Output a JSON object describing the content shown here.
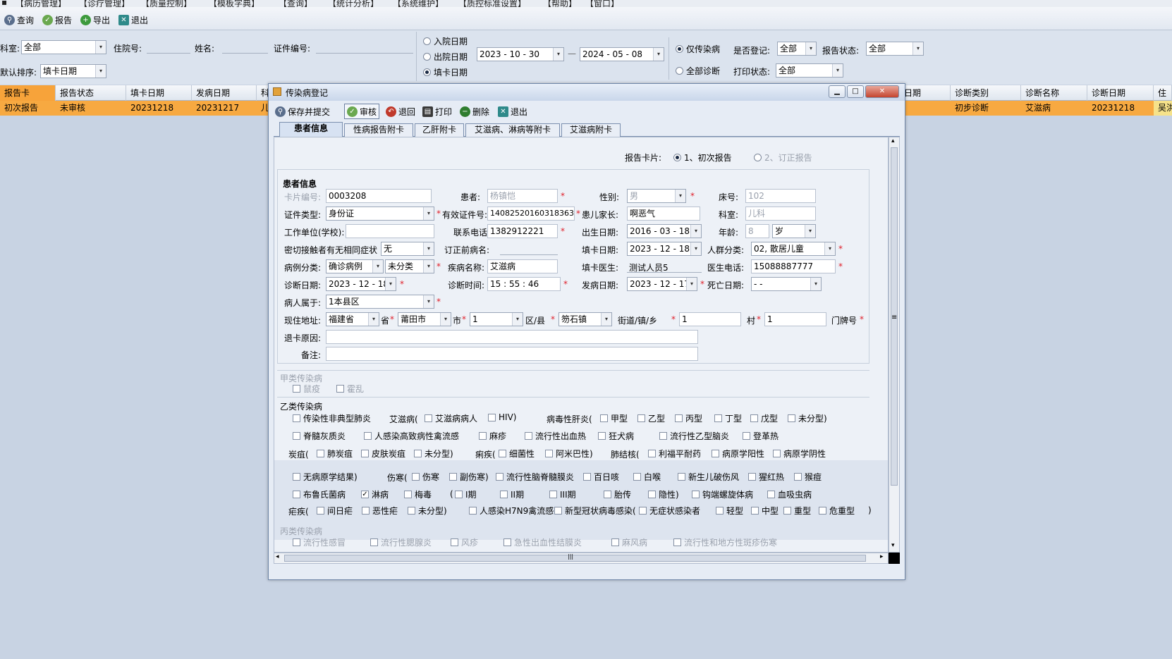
{
  "menubar": [
    "【病历管理】",
    "【诊疗管理】",
    "【质量控制】",
    "【模板字典】",
    "【查询】",
    "【统计分析】",
    "【系统维护】",
    "【质控标准设置】",
    "【帮助】",
    "【窗口】"
  ],
  "toolbar": {
    "query": "查询",
    "report": "报告",
    "export": "导出",
    "exit": "退出"
  },
  "filters": {
    "dept_label": "科室:",
    "dept_value": "全部",
    "inpatient_label": "住院号:",
    "name_label": "姓名:",
    "cert_label": "证件编号:",
    "sort_label": "默认排序:",
    "sort_value": "填卡日期",
    "date_admit": "入院日期",
    "date_discharge": "出院日期",
    "date_card": "填卡日期",
    "date_from": "2023 - 10 - 30",
    "date_to": "2024 - 05 - 08",
    "dash": "—",
    "only_infect": "仅传染病",
    "all_diag": "全部诊断",
    "registered_label": "是否登记:",
    "registered_value": "全部",
    "report_status_label": "报告状态:",
    "report_status_value": "全部",
    "print_status_label": "打印状态:",
    "print_status_value": "全部"
  },
  "grid": {
    "headers_left": [
      "报告卡",
      "报告状态",
      "填卡日期",
      "发病日期",
      "科"
    ],
    "headers_right": [
      "日期",
      "诊断类别",
      "诊断名称",
      "诊断日期",
      "住"
    ],
    "row_left": [
      "初次报告",
      "未审核",
      "20231218",
      "20231217",
      "儿"
    ],
    "row_right": [
      "初步诊断",
      "艾滋病",
      "20231218",
      "吴洪"
    ]
  },
  "dialog": {
    "title": "传染病登记",
    "toolbar": {
      "save": "保存并提交",
      "audit": "审核",
      "back": "退回",
      "print": "打印",
      "delete": "删除",
      "exit": "退出"
    },
    "tabs": [
      "患者信息",
      "性病报告附卡",
      "乙肝附卡",
      "艾滋病、淋病等附卡",
      "艾滋病附卡"
    ],
    "report_card_label": "报告卡片:",
    "report_first": "1、初次报告",
    "report_correct": "2、订正报告",
    "section_patient": "患者信息",
    "f": {
      "card_no_l": "卡片编号:",
      "card_no": "0003208",
      "patient_l": "患者:",
      "patient": "杨镇恺",
      "sex_l": "性别:",
      "sex": "男",
      "bed_l": "床号:",
      "bed": "102",
      "idtype_l": "证件类型:",
      "idtype": "身份证",
      "idno_l": "有效证件号:",
      "idno": "140825201603183630",
      "parent_l": "患儿家长:",
      "parent": "啊恶气",
      "dept_l": "科室:",
      "dept": "儿科",
      "work_l": "工作单位(学校):",
      "work": "",
      "phone_l": "联系电话:",
      "phone": "1382912221",
      "birth_l": "出生日期:",
      "birth": "2016 - 03 - 18",
      "age_l": "年龄:",
      "age": "8",
      "age_unit": "岁",
      "contact_l": "密切接触者有无相同症状",
      "contact": "无",
      "prev_l": "订正前病名:",
      "prev": "",
      "filldate_l": "填卡日期:",
      "filldate": "2023 - 12 - 18",
      "crowd_l": "人群分类:",
      "crowd": "02, 散居儿童",
      "case_l": "病例分类:",
      "case1": "确诊病例",
      "case2": "未分类",
      "disease_l": "疾病名称:",
      "disease": "艾滋病",
      "doctor_l": "填卡医生:",
      "doctor": "测试人员5",
      "docphone_l": "医生电话:",
      "docphone": "15088887777",
      "diagdate_l": "诊断日期:",
      "diagdate": "2023 - 12 - 18",
      "diagtime_l": "诊断时间:",
      "diagtime": "15 : 55 : 46",
      "onset_l": "发病日期:",
      "onset": "2023 - 12 - 17",
      "death_l": "死亡日期:",
      "death": " -  - ",
      "belong_l": "病人属于:",
      "belong": "1本县区",
      "addr_l": "现住地址:",
      "prov": "福建省",
      "prov_l": "省",
      "city": "莆田市",
      "city_l": "市",
      "dist": "1",
      "dist_l": "区/县",
      "town": "笏石镇",
      "town_l": "街道/镇/乡",
      "village": "1",
      "village_l": "村",
      "door_l": "门牌号",
      "reject_l": "退卡原因:",
      "note_l": "备注:"
    },
    "class_a": "甲类传染病",
    "a": [
      "鼠疫",
      "霍乱"
    ],
    "class_b": "乙类传染病",
    "b1": [
      "传染性非典型肺炎",
      "艾滋病(",
      "艾滋病病人",
      "HIV)",
      "病毒性肝炎(",
      "甲型",
      "乙型",
      "丙型",
      "丁型",
      "戊型",
      "未分型)"
    ],
    "b2": [
      "脊髓灰质炎",
      "人感染高致病性禽流感",
      "麻疹",
      "流行性出血热",
      "狂犬病",
      "流行性乙型脑炎",
      "登革热"
    ],
    "b3": [
      "炭疽(",
      "肺炭疽",
      "皮肤炭疽",
      "未分型)",
      "痢疾(",
      "细菌性",
      "阿米巴性)",
      "肺结核(",
      "利福平耐药",
      "病原学阳性",
      "病原学阴性"
    ],
    "b4": [
      "无病原学结果)",
      "伤寒(",
      "伤寒",
      "副伤寒)",
      "流行性脑脊髓膜炎",
      "百日咳",
      "白喉",
      "新生儿破伤风",
      "猩红热",
      "猴痘"
    ],
    "b5": [
      "布鲁氏菌病",
      "淋病",
      "梅毒",
      "(",
      "I期",
      "II期",
      "III期",
      "胎传",
      "隐性)",
      "钩端螺旋体病",
      "血吸虫病"
    ],
    "b6": [
      "疟疾(",
      "间日疟",
      "恶性疟",
      "未分型)",
      "人感染H7N9禽流感",
      "新型冠状病毒感染(",
      "无症状感染者",
      "轻型",
      "中型",
      "重型",
      "危重型",
      ")"
    ],
    "class_c": "丙类传染病",
    "c1": [
      "流行性感冒",
      "流行性腮腺炎",
      "风疹",
      "急性出血性结膜炎",
      "麻风病",
      "流行性和地方性斑疹伤寒"
    ],
    "scroll_mark": "|||",
    "glyphs": {
      "dd": "▾",
      "chk": "✓",
      "min": "▁",
      "max": "□",
      "close": "✕",
      "up": "▴",
      "down": "▾",
      "left": "◂",
      "right": "▸",
      "grip": "≡"
    }
  },
  "colors": {
    "accent": "#f7a941",
    "selected": "#f6e28a",
    "required": "#e0202a"
  }
}
